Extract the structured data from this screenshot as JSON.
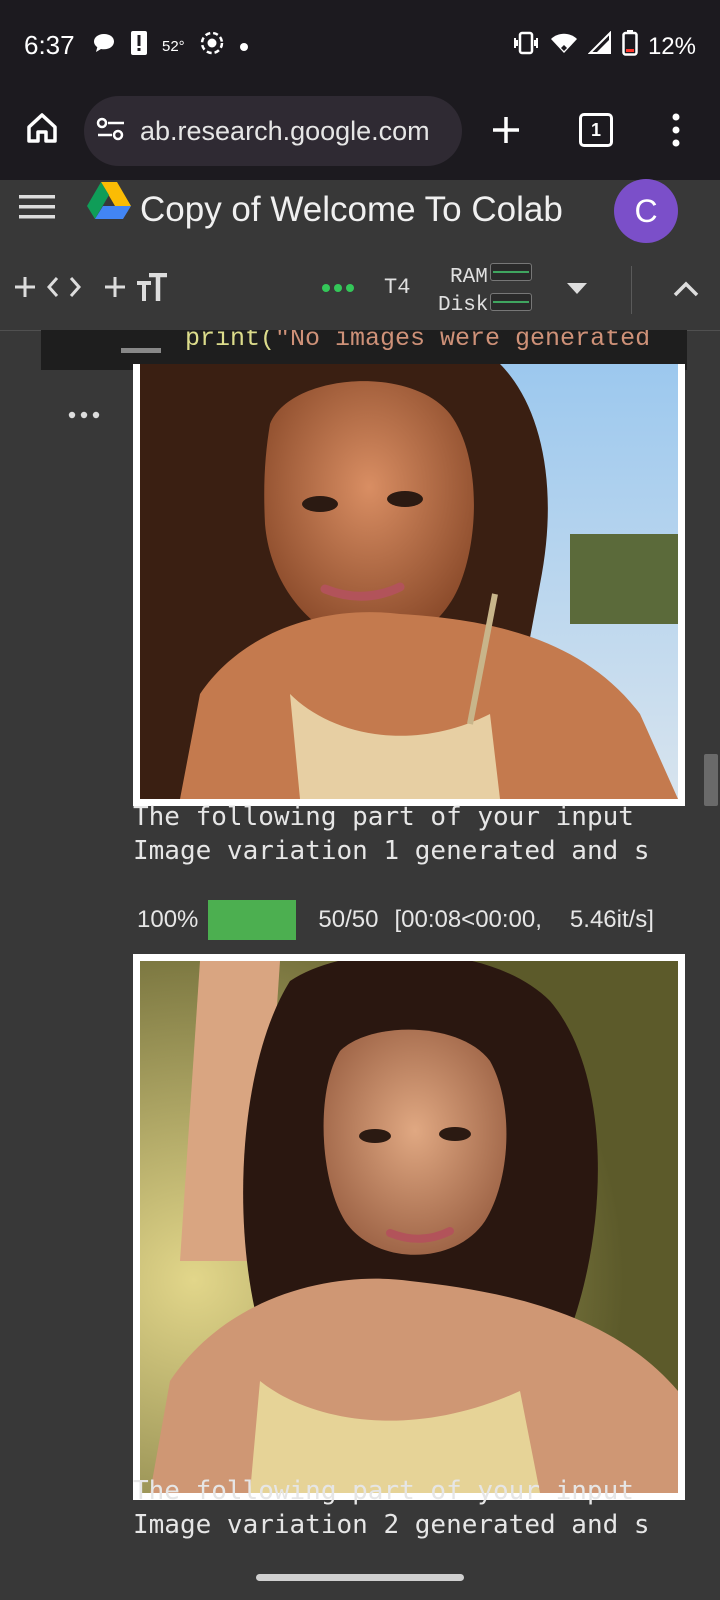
{
  "status_bar": {
    "time": "6:37",
    "temperature": "52°",
    "battery": "12%"
  },
  "browser": {
    "url_text": "ab.research.google.com",
    "tab_count": "1"
  },
  "colab": {
    "notebook_title": "Copy of Welcome To Colab",
    "avatar_letter": "C",
    "runtime_type": "T4",
    "ram_label": "RAM",
    "disk_label": "Disk"
  },
  "cell": {
    "code_fn": "print(",
    "code_str": "\"No images were generated"
  },
  "output": {
    "line1": "The following part of your input",
    "line2": "Image variation 1 generated and s",
    "progress_percent_label": "100%",
    "progress_fraction": 1.0,
    "progress_steps": "50/50",
    "progress_time": "[00:08<00:00,",
    "progress_rate": "5.46it/s]",
    "line3": "The following part of your input",
    "line4": "Image variation 2 generated and s"
  },
  "colors": {
    "accent_green": "#4caf50",
    "avatar_purple": "#7b4fc9",
    "dots_green": "#34c759"
  }
}
